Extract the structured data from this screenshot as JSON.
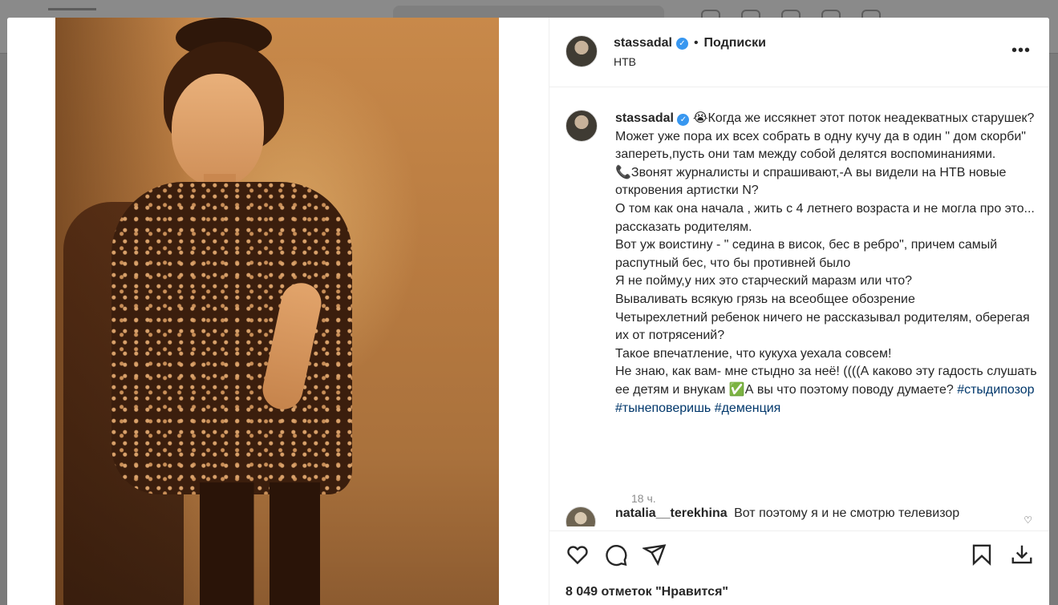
{
  "post": {
    "username": "stassadal",
    "follow_label": "Подписки",
    "location": "НТВ",
    "more_label": "•••"
  },
  "caption": {
    "username": "stassadal",
    "lines": [
      "😭Когда же иссякнет этот поток неадекватных старушек?",
      "Может уже пора их всех собрать в одну кучу да в один \" дом скорби\" запереть,пусть они там между собой делятся воспоминаниями.",
      "📞Звонят журналисты и спрашивают,-А вы видели на НТВ новые откровения артистки N?",
      "О том как она начала , жить с 4 летнего возраста и не могла про это... рассказать родителям.",
      "Вот уж воистину - \" седина в висок, бес в ребро\", причем самый распутный бес, что бы противней было",
      "Я не пойму,у них это старческий маразм или что?",
      "Вываливать всякую грязь на всеобщее обозрение",
      "Четырехлетний ребенок ничего не рассказывал родителям, оберегая их от потрясений?",
      "Такое впечатление, что кукуха уехала совсем!",
      "Не знаю, как вам- мне стыдно за неё! ((((А каково эту гадость слушать ее детям и внукам ✅А вы что поэтому поводу думаете?"
    ],
    "hashtags": "#стыдипозор #тынеповеришь #деменция",
    "time": "18 ч."
  },
  "comment": {
    "username": "natalia__terekhina",
    "text": "Вот поэтому я и не смотрю телевизор"
  },
  "likes": "8 049 отметок \"Нравится\"",
  "icons": {
    "like": "heart-icon",
    "comment": "comment-icon",
    "share": "share-icon",
    "save": "bookmark-icon",
    "download": "download-icon"
  }
}
